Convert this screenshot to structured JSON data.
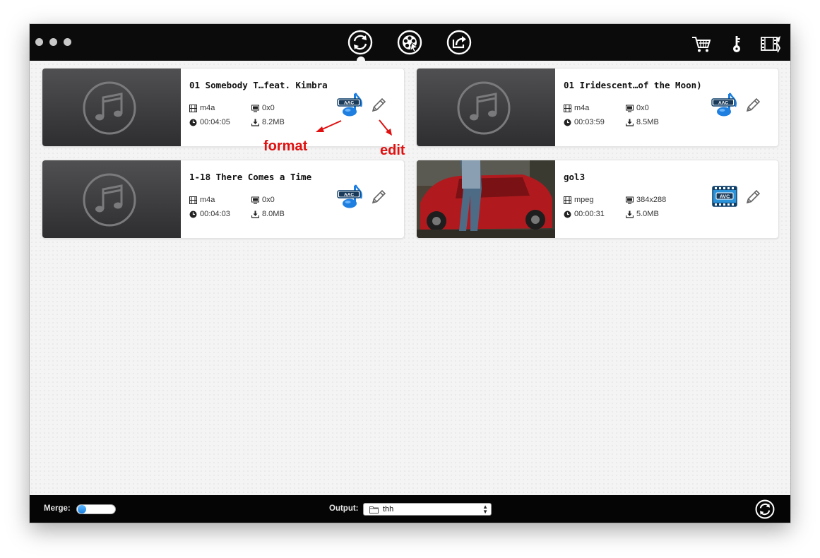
{
  "toolbar": {
    "tools": [
      {
        "name": "convert",
        "icon": "convert-icon",
        "active": true
      },
      {
        "name": "media-add",
        "icon": "film-reel-icon",
        "active": false
      },
      {
        "name": "share",
        "icon": "share-icon",
        "active": false
      }
    ],
    "right_icons": [
      "cart-icon",
      "key-icon",
      "video-edit-icon"
    ]
  },
  "items": [
    {
      "title": "01 Somebody T…feat. Kimbra",
      "format": "m4a",
      "resolution": "0x0",
      "duration": "00:04:05",
      "size": "8.2MB",
      "codec": "AAC",
      "thumb": "music-icon"
    },
    {
      "title": "01 Iridescent…of the Moon)",
      "format": "m4a",
      "resolution": "0x0",
      "duration": "00:03:59",
      "size": "8.5MB",
      "codec": "AAC",
      "thumb": "music-icon"
    },
    {
      "title": "1-18 There Comes a Time",
      "format": "m4a",
      "resolution": "0x0",
      "duration": "00:04:03",
      "size": "8.0MB",
      "codec": "AAC",
      "thumb": "music-icon"
    },
    {
      "title": "gol3",
      "format": "mpeg",
      "resolution": "384x288",
      "duration": "00:00:31",
      "size": "5.0MB",
      "codec": "AVC",
      "thumb": "video-frame"
    }
  ],
  "annotations": {
    "format_label": "format",
    "edit_label": "edit"
  },
  "bottombar": {
    "merge_label": "Merge:",
    "merge_on": false,
    "output_label": "Output:",
    "output_value": "thh"
  },
  "colors": {
    "accent_blue": "#1a7fe0",
    "annotation_red": "#e01010",
    "bar_black": "#0b0b0b"
  }
}
